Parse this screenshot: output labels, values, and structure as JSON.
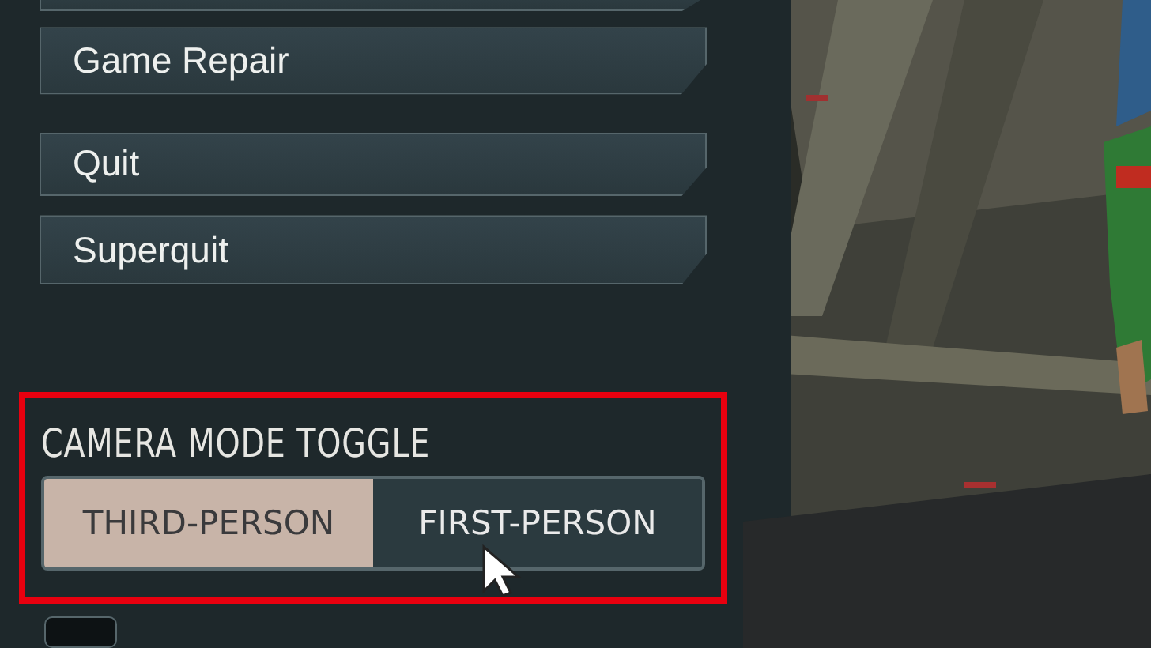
{
  "menu_buttons": [
    {
      "label": "Game Repair"
    },
    {
      "label": "Quit"
    },
    {
      "label": "Superquit"
    }
  ],
  "camera_mode": {
    "title": "CAMERA MODE TOGGLE",
    "highlighted": true,
    "options": [
      {
        "label": "THIRD-PERSON",
        "selected": true
      },
      {
        "label": "FIRST-PERSON",
        "selected": false
      }
    ]
  }
}
